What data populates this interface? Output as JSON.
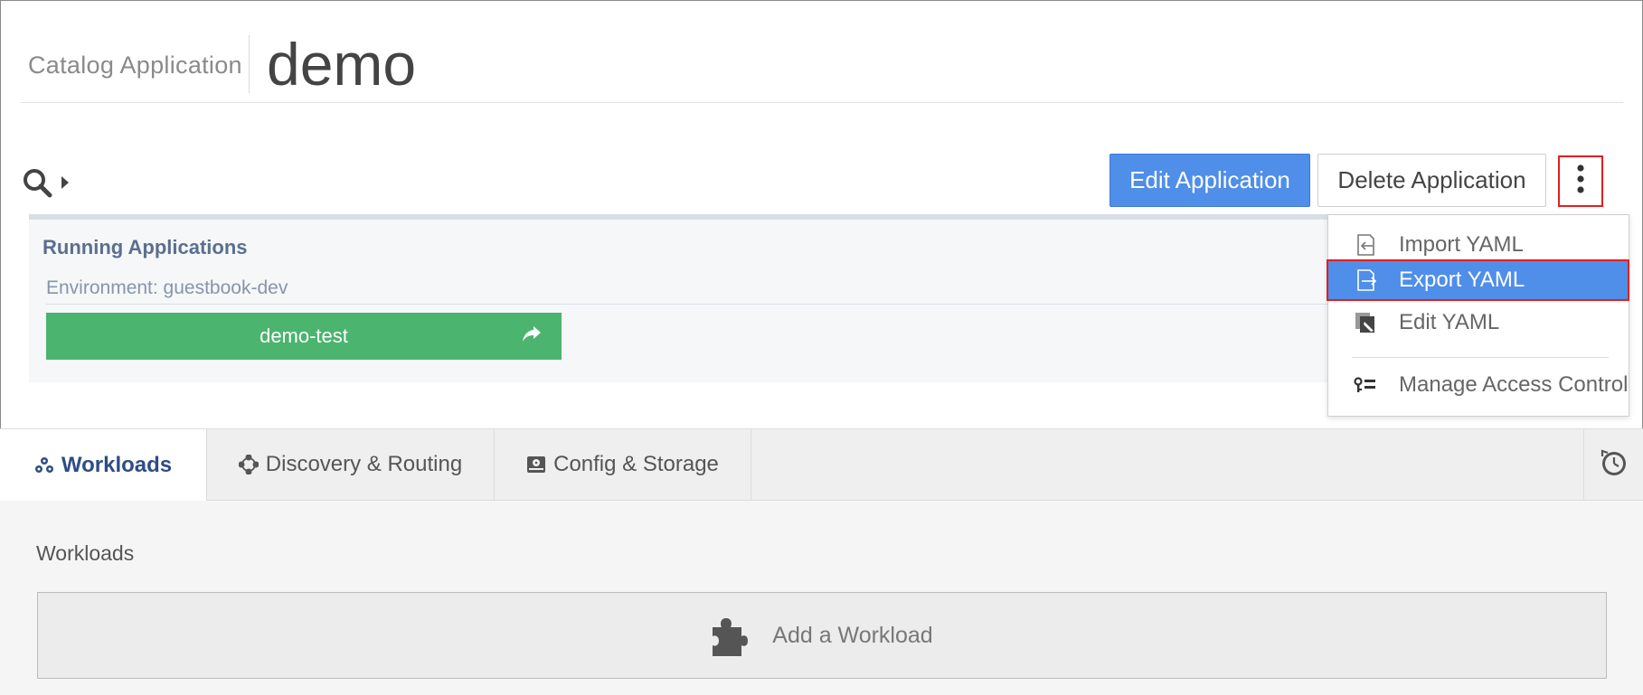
{
  "header": {
    "breadcrumb": "Catalog Application",
    "title": "demo"
  },
  "toolbar": {
    "search_icon": "search-icon",
    "edit_label": "Edit Application",
    "delete_label": "Delete Application",
    "more_icon": "vertical-ellipsis-icon"
  },
  "running": {
    "title": "Running Applications",
    "environment_label": "Environment: guestbook-dev",
    "apps": [
      {
        "name": "demo-test",
        "icon": "share-icon"
      }
    ]
  },
  "menu": {
    "items": [
      {
        "label": "Import YAML",
        "icon": "import-icon"
      },
      {
        "label": "Export YAML",
        "icon": "export-icon",
        "active": true
      },
      {
        "label": "Edit YAML",
        "icon": "edit-yaml-icon"
      },
      {
        "label": "Manage Access Control",
        "icon": "access-control-icon"
      }
    ]
  },
  "tabs": [
    {
      "label": "Workloads",
      "icon": "workloads-icon",
      "active": true
    },
    {
      "label": "Discovery & Routing",
      "icon": "discovery-icon"
    },
    {
      "label": "Config & Storage",
      "icon": "storage-icon"
    }
  ],
  "history_icon": "history-icon",
  "content": {
    "section_title": "Workloads",
    "add_label": "Add a Workload",
    "add_icon": "puzzle-icon"
  },
  "colors": {
    "primary": "#4f8ee9",
    "success": "#4bb46f",
    "highlight_border": "#e02020",
    "tab_active_text": "#2e4d86"
  }
}
